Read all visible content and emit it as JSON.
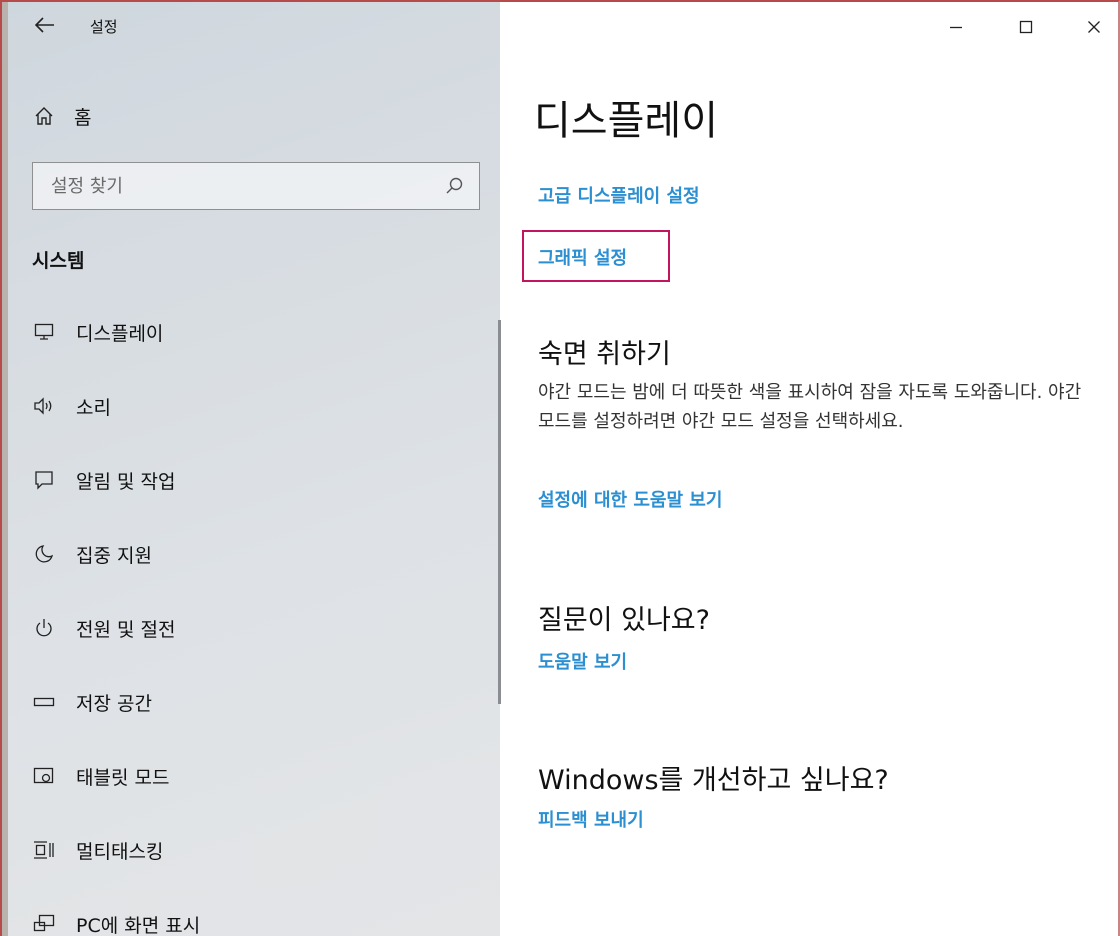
{
  "window": {
    "app_title": "설정",
    "controls": {
      "minimize": "—",
      "maximize": "☐",
      "close": "✕"
    }
  },
  "sidebar": {
    "home_label": "홈",
    "search_placeholder": "설정 찾기",
    "section_title": "시스템",
    "items": [
      {
        "label": "디스플레이",
        "icon": "monitor-icon"
      },
      {
        "label": "소리",
        "icon": "speaker-icon"
      },
      {
        "label": "알림 및 작업",
        "icon": "notification-icon"
      },
      {
        "label": "집중 지원",
        "icon": "moon-icon"
      },
      {
        "label": "전원 및 절전",
        "icon": "power-icon"
      },
      {
        "label": "저장 공간",
        "icon": "storage-icon"
      },
      {
        "label": "태블릿 모드",
        "icon": "tablet-icon"
      },
      {
        "label": "멀티태스킹",
        "icon": "multitasking-icon"
      },
      {
        "label": "PC에 화면 표시",
        "icon": "project-icon"
      }
    ]
  },
  "main": {
    "title": "디스플레이",
    "advanced_display_link": "고급 디스플레이 설정",
    "graphics_settings_link": "그래픽 설정",
    "sleep_better": {
      "heading": "숙면 취하기",
      "body": "야간 모드는 밤에 더 따뜻한 색을 표시하여 잠을 자도록 도와줍니다. 야간 모드를 설정하려면 야간 모드 설정을 선택하세요.",
      "link": "설정에 대한 도움말 보기"
    },
    "questions": {
      "heading": "질문이 있나요?",
      "link": "도움말 보기"
    },
    "improve": {
      "heading": "Windows를 개선하고 싶나요?",
      "link": "피드백 보내기"
    }
  },
  "colors": {
    "link": "#2b8fd1",
    "highlight_box": "#c2155e",
    "window_border": "#b74b4b"
  }
}
